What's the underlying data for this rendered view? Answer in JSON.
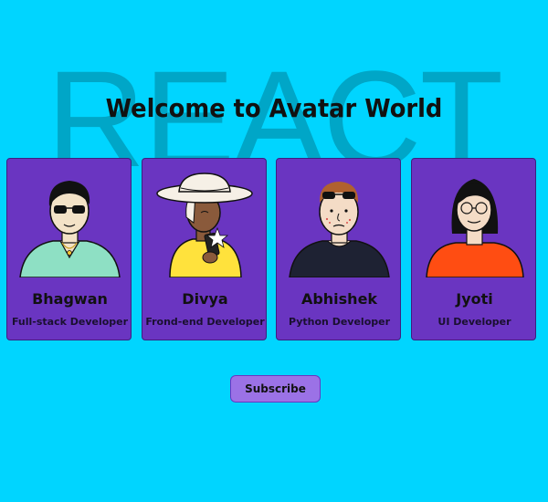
{
  "watermark": "REACT",
  "page": {
    "title": "Welcome to Avatar World"
  },
  "cards": [
    {
      "name": "Bhagwan",
      "role": "Full-stack Developer"
    },
    {
      "name": "Divya",
      "role": "Frond-end Developer"
    },
    {
      "name": "Abhishek",
      "role": "Python Developer"
    },
    {
      "name": "Jyoti",
      "role": "UI Developer"
    }
  ],
  "subscribe_label": "Subscribe",
  "colors": {
    "background": "#00d5ff",
    "card": "#6a35c1",
    "button": "#9b72e6"
  }
}
